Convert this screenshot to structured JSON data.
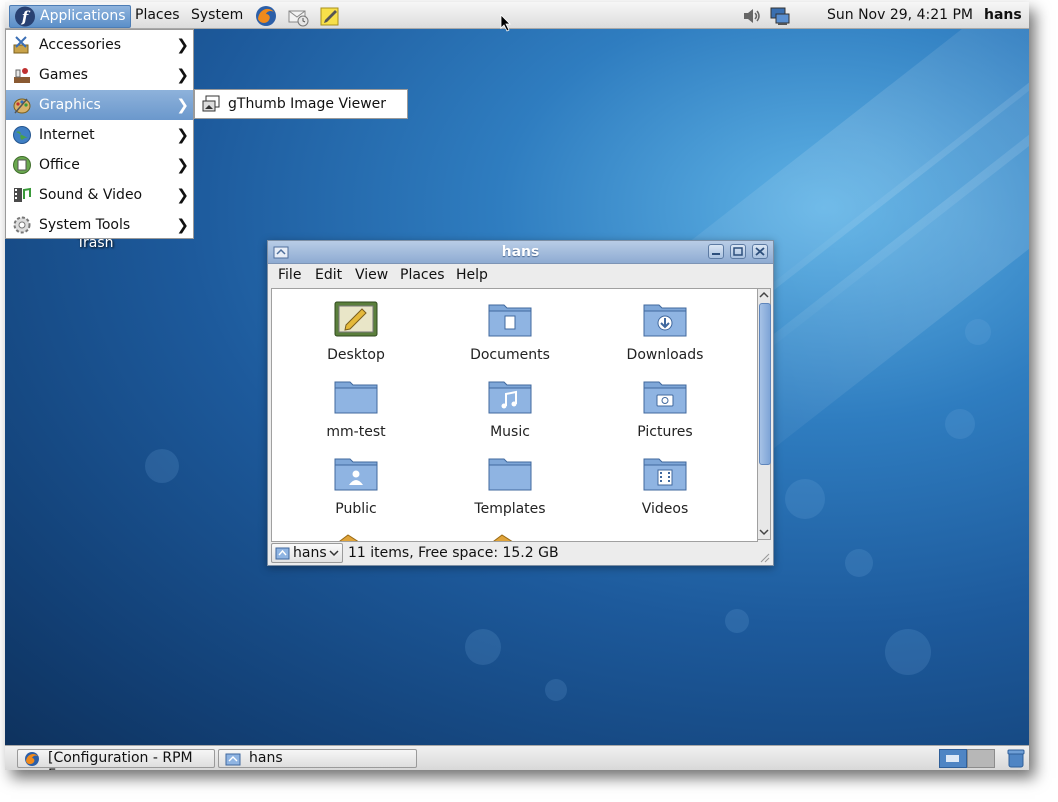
{
  "top_panel": {
    "menus": [
      "Applications",
      "Places",
      "System"
    ],
    "clock": "Sun Nov 29,  4:21 PM",
    "user": "hans"
  },
  "applications_menu": {
    "items": [
      {
        "label": "Accessories",
        "icon": "accessories-icon",
        "selected": false
      },
      {
        "label": "Games",
        "icon": "games-icon",
        "selected": false
      },
      {
        "label": "Graphics",
        "icon": "graphics-icon",
        "selected": true
      },
      {
        "label": "Internet",
        "icon": "internet-icon",
        "selected": false
      },
      {
        "label": "Office",
        "icon": "office-icon",
        "selected": false
      },
      {
        "label": "Sound & Video",
        "icon": "sound-video-icon",
        "selected": false
      },
      {
        "label": "System Tools",
        "icon": "system-tools-icon",
        "selected": false
      }
    ]
  },
  "graphics_submenu": {
    "items": [
      {
        "label": "gThumb Image Viewer",
        "icon": "gthumb-icon"
      }
    ]
  },
  "desktop": {
    "trash_label": "Trash"
  },
  "file_window": {
    "title": "hans",
    "menu": [
      "File",
      "Edit",
      "View",
      "Places",
      "Help"
    ],
    "folders": [
      {
        "name": "Desktop",
        "icon": "desktop-folder-icon"
      },
      {
        "name": "Documents",
        "icon": "documents-folder-icon"
      },
      {
        "name": "Downloads",
        "icon": "downloads-folder-icon"
      },
      {
        "name": "mm-test",
        "icon": "folder-icon"
      },
      {
        "name": "Music",
        "icon": "music-folder-icon"
      },
      {
        "name": "Pictures",
        "icon": "pictures-folder-icon"
      },
      {
        "name": "Public",
        "icon": "public-folder-icon"
      },
      {
        "name": "Templates",
        "icon": "templates-folder-icon"
      },
      {
        "name": "Videos",
        "icon": "videos-folder-icon"
      }
    ],
    "location": "hans",
    "status": "11 items, Free space: 15.2 GB"
  },
  "taskbar": {
    "tasks": [
      {
        "label": "[Configuration - RPM F...",
        "icon": "firefox-icon"
      },
      {
        "label": "hans",
        "icon": "folder-icon"
      }
    ]
  },
  "colors": {
    "selection": "#6b98cc",
    "folder": "#7fa7d8",
    "desktop": "#1d5a9c"
  }
}
